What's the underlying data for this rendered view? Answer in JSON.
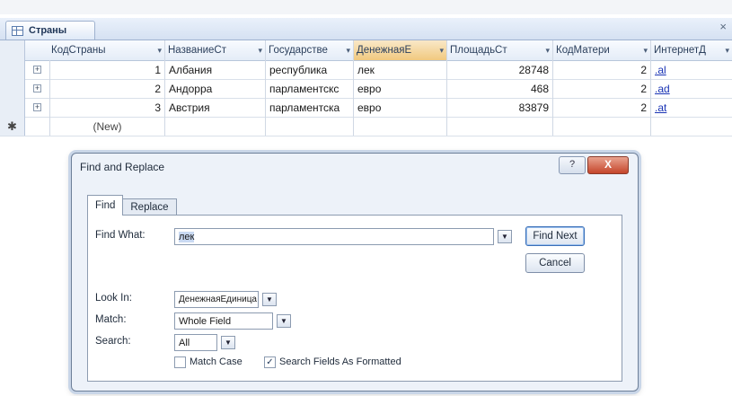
{
  "window": {
    "tab_title": "Страны",
    "close_glyph": "×"
  },
  "table": {
    "columns": [
      {
        "label": "КодСтраны",
        "arrow": "▾"
      },
      {
        "label": "НазваниеСт",
        "arrow": "▾"
      },
      {
        "label": "Государстве",
        "arrow": "▾"
      },
      {
        "label": "ДенежнаяЕ",
        "arrow": "▾"
      },
      {
        "label": "ПлощадьСт",
        "arrow": "▾"
      },
      {
        "label": "КодМатери",
        "arrow": "▾"
      },
      {
        "label": "ИнтернетД",
        "arrow": "▾"
      }
    ],
    "rows": [
      {
        "id": "1",
        "name": "Албания",
        "gov": "республика",
        "currency": "лек",
        "area": "28748",
        "lang": "2",
        "net": ".al"
      },
      {
        "id": "2",
        "name": "Андорра",
        "gov": "парламентскс",
        "currency": "евро",
        "area": "468",
        "lang": "2",
        "net": ".ad"
      },
      {
        "id": "3",
        "name": "Австрия",
        "gov": "парламентска",
        "currency": "евро",
        "area": "83879",
        "lang": "2",
        "net": ".at"
      }
    ],
    "new_row_label": "(New)",
    "new_row_marker": "✱",
    "expand_glyph": "+"
  },
  "dialog": {
    "title": "Find and Replace",
    "help_glyph": "?",
    "close_glyph": "X",
    "tabs": {
      "find": "Find",
      "replace": "Replace"
    },
    "find_what_label": "Find What:",
    "find_what_value": "лек",
    "look_in_label": "Look In:",
    "look_in_value": "ДенежнаяЕдиница",
    "match_label": "Match:",
    "match_value": "Whole Field",
    "search_label": "Search:",
    "search_value": "All",
    "match_case_label": "Match Case",
    "match_case_checked": false,
    "search_formatted_label": "Search Fields As Formatted",
    "search_formatted_checked": true,
    "find_next_label": "Find Next",
    "cancel_label": "Cancel",
    "dropdown_glyph": "▼",
    "check_glyph": "✓"
  }
}
